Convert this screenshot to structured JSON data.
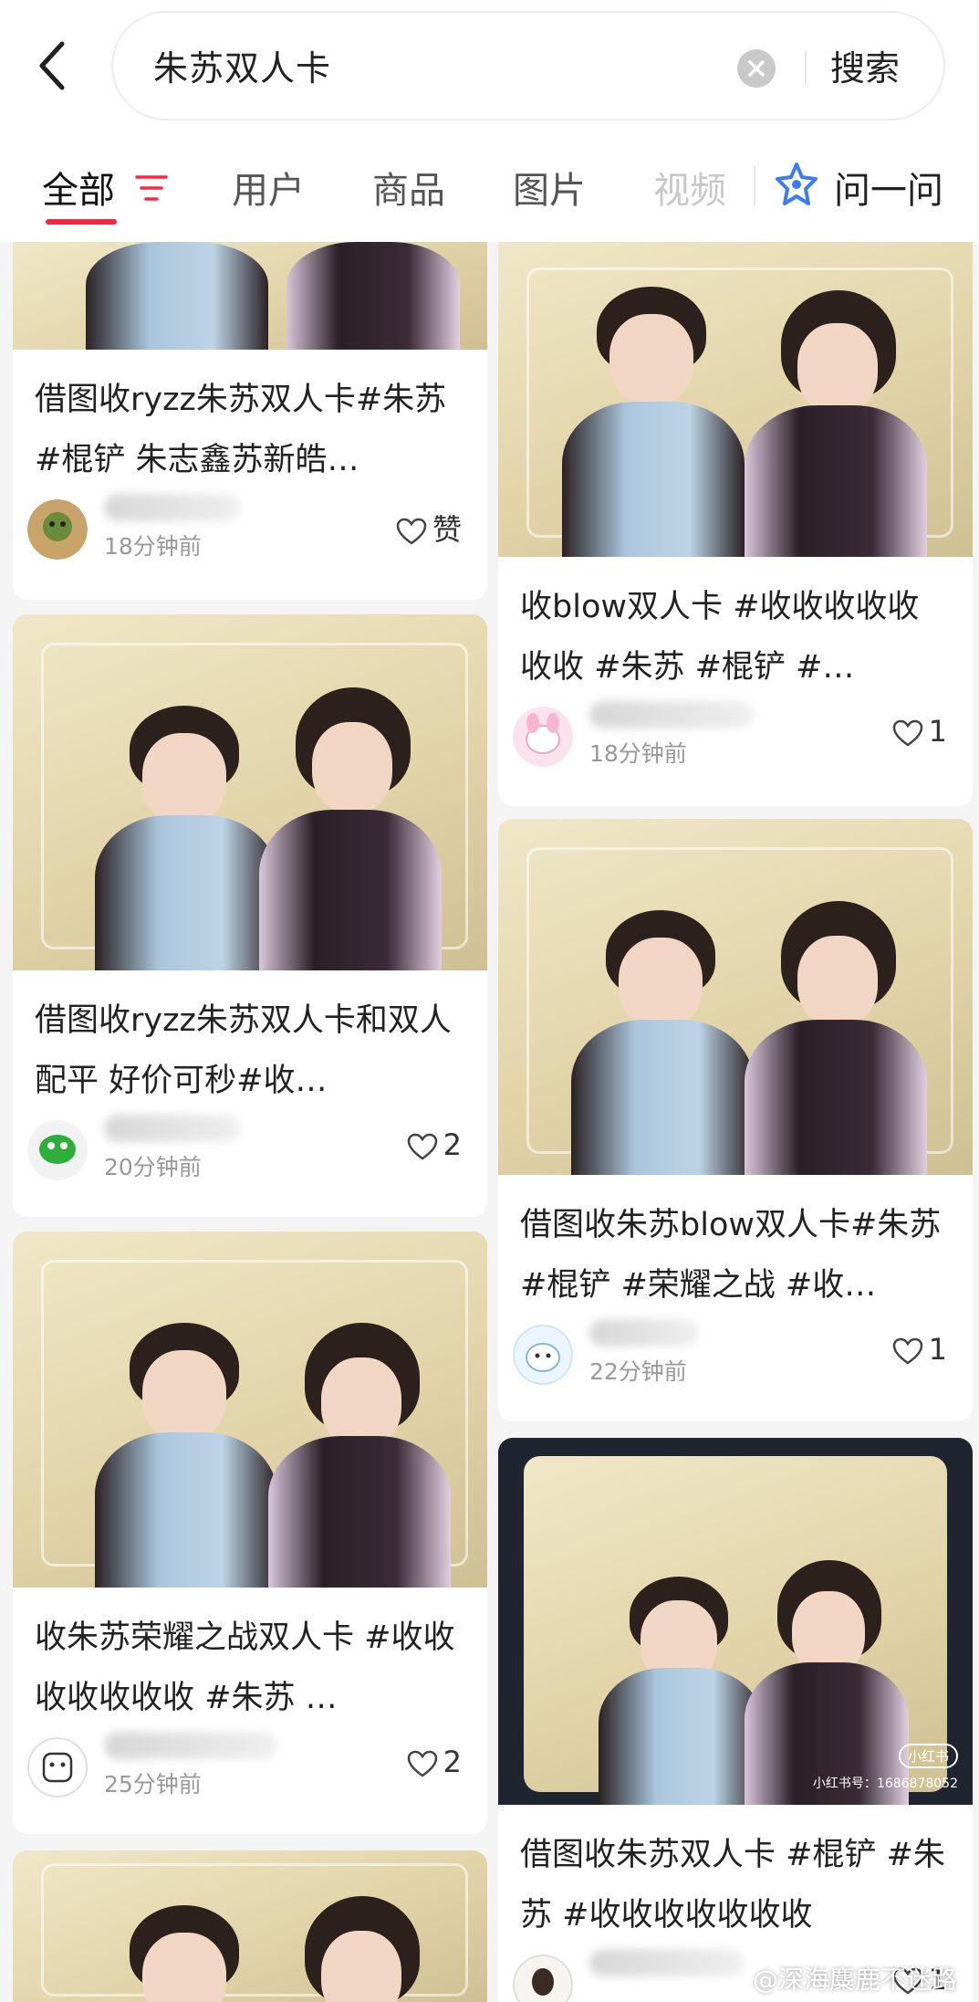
{
  "search": {
    "query": "朱苏双人卡",
    "submit_label": "搜索"
  },
  "tabs": [
    {
      "label": "全部"
    },
    {
      "label": "用户"
    },
    {
      "label": "商品"
    },
    {
      "label": "图片"
    },
    {
      "label": "视频"
    }
  ],
  "ask_label": "问一问",
  "left_cards": [
    {
      "title": "借图收ryzz朱苏双人卡#朱苏 #棍铲  朱志鑫苏新皓…",
      "time": "18分钟前",
      "likes": "赞"
    },
    {
      "title": "借图收ryzz朱苏双人卡和双人配平 好价可秒#收…",
      "time": "20分钟前",
      "likes": "2"
    },
    {
      "title": "收朱苏荣耀之战双人卡 #收收收收收收收 #朱苏 …",
      "time": "25分钟前",
      "likes": "2"
    }
  ],
  "right_cards": [
    {
      "title": "收blow双人卡 #收收收收收收收 #朱苏 #棍铲 #…",
      "time": "18分钟前",
      "likes": "1"
    },
    {
      "title": "借图收朱苏blow双人卡#朱苏 #棍铲 #荣耀之战 #收…",
      "time": "22分钟前",
      "likes": "1"
    },
    {
      "title": "借图收朱苏双人卡 #棍铲 #朱苏 #收收收收收收收",
      "time": "",
      "likes": "1"
    }
  ],
  "photo_watermark": {
    "badge": "小红书",
    "id_text": "小红书号：1686878052"
  },
  "weibo_watermark": "@深海麋鹿不迷路",
  "colors": {
    "accent": "#ff2442",
    "background": "#f4f4f4"
  },
  "icons": {
    "back": "chevron-left-icon",
    "clear": "close-circle-icon",
    "filter": "filter-lines-icon",
    "ask": "sparkle-star-icon",
    "like": "heart-outline-icon"
  }
}
